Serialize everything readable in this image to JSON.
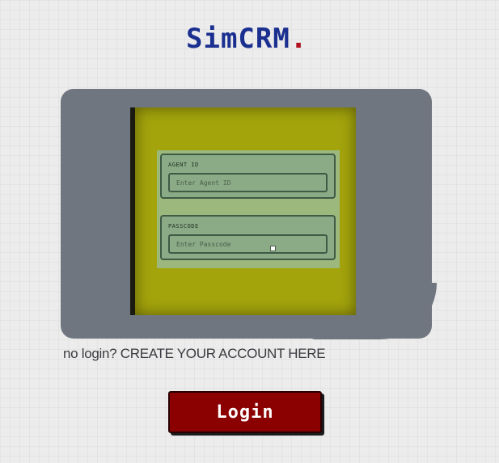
{
  "brand": {
    "name": "SimCRM",
    "dot": "."
  },
  "form": {
    "agent_id": {
      "label": "AGENT ID",
      "placeholder": "Enter Agent ID",
      "value": ""
    },
    "passcode": {
      "label": "PASSCODE",
      "placeholder": "Enter Passcode",
      "value": ""
    }
  },
  "signup": {
    "prefix": "no login?",
    "link_label": "CREATE YOUR ACCOUNT HERE"
  },
  "actions": {
    "login_label": "Login"
  },
  "colors": {
    "brand_blue": "#1a2f8f",
    "brand_dot_red": "#b01020",
    "device_gray": "#707680",
    "screen_yellow": "#a3a30c",
    "panel_green": "#9cb87c",
    "login_red": "#8b0000"
  }
}
